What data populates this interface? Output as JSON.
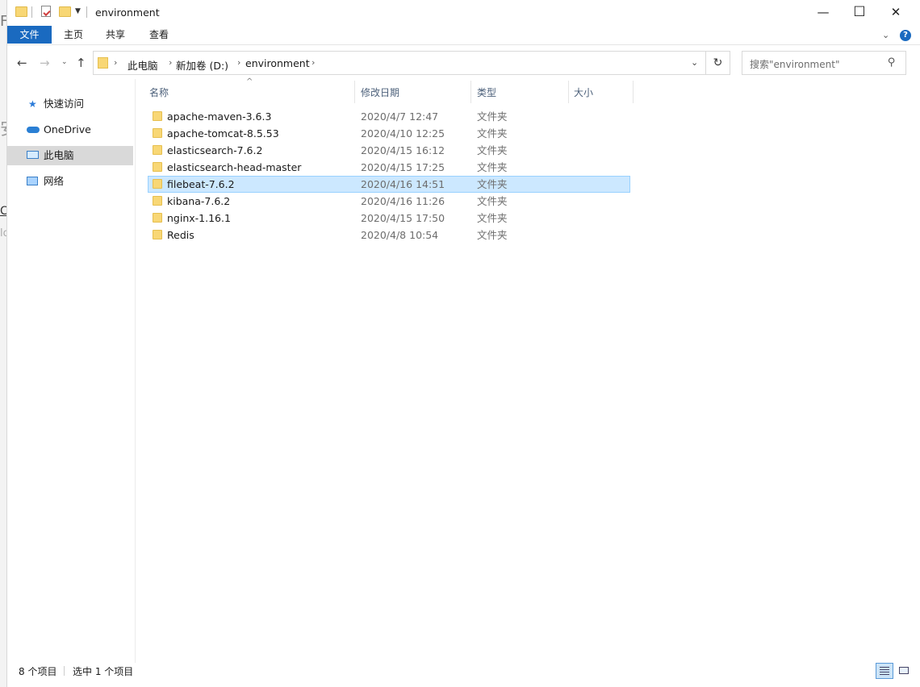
{
  "window": {
    "title": "environment",
    "controls": {
      "minimize": "—",
      "maximize": "☐",
      "close": "✕"
    }
  },
  "ribbon": {
    "tabs": [
      {
        "label": "文件"
      },
      {
        "label": "主页"
      },
      {
        "label": "共享"
      },
      {
        "label": "查看"
      }
    ],
    "help_icon": "?"
  },
  "address": {
    "breadcrumbs": [
      "此电脑",
      "新加卷 (D:)",
      "environment"
    ],
    "search_placeholder": "搜索\"environment\""
  },
  "nav_pane": {
    "items": [
      {
        "label": "快速访问",
        "icon": "star-icon"
      },
      {
        "label": "OneDrive",
        "icon": "cloud-icon"
      },
      {
        "label": "此电脑",
        "icon": "computer-icon",
        "selected": true
      },
      {
        "label": "网络",
        "icon": "network-icon"
      }
    ]
  },
  "columns": {
    "name": "名称",
    "date": "修改日期",
    "type": "类型",
    "size": "大小"
  },
  "files": [
    {
      "name": "apache-maven-3.6.3",
      "date": "2020/4/7 12:47",
      "type": "文件夹"
    },
    {
      "name": "apache-tomcat-8.5.53",
      "date": "2020/4/10 12:25",
      "type": "文件夹"
    },
    {
      "name": "elasticsearch-7.6.2",
      "date": "2020/4/15 16:12",
      "type": "文件夹"
    },
    {
      "name": "elasticsearch-head-master",
      "date": "2020/4/15 17:25",
      "type": "文件夹"
    },
    {
      "name": "filebeat-7.6.2",
      "date": "2020/4/16 14:51",
      "type": "文件夹",
      "selected": true
    },
    {
      "name": "kibana-7.6.2",
      "date": "2020/4/16 11:26",
      "type": "文件夹"
    },
    {
      "name": "nginx-1.16.1",
      "date": "2020/4/15 17:50",
      "type": "文件夹"
    },
    {
      "name": "Redis",
      "date": "2020/4/8 10:54",
      "type": "文件夹"
    }
  ],
  "status": {
    "item_count": "8 个项目",
    "selection": "选中 1 个项目"
  },
  "background_fragments": [
    "F",
    "安",
    "C",
    "lo"
  ],
  "colors": {
    "accent": "#1a6ac0",
    "selection": "#cce8ff",
    "folder": "#f8d775"
  }
}
